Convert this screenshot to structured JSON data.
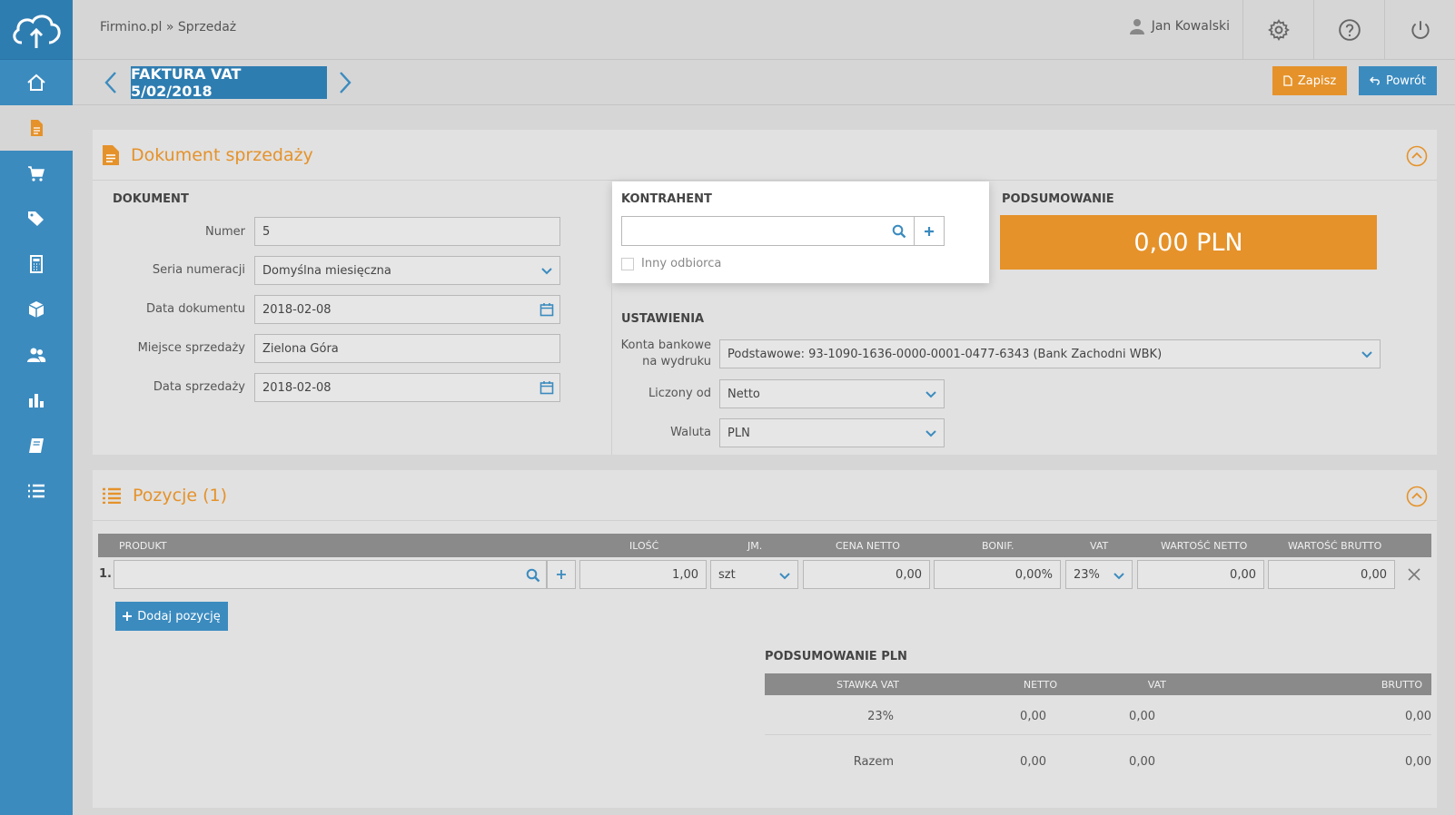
{
  "header": {
    "breadcrumb": "Firmino.pl » Sprzedaż",
    "user_name": "Jan Kowalski"
  },
  "toolbar": {
    "document_title": "FAKTURA VAT 5/02/2018",
    "save_label": "Zapisz",
    "back_label": "Powrót"
  },
  "sales_panel": {
    "title": "Dokument sprzedaży",
    "dokument": {
      "section_label": "DOKUMENT",
      "numer_label": "Numer",
      "numer_value": "5",
      "seria_label": "Seria numeracji",
      "seria_value": "Domyślna miesięczna",
      "data_dok_label": "Data dokumentu",
      "data_dok_value": "2018-02-08",
      "miejsce_label": "Miejsce sprzedaży",
      "miejsce_value": "Zielona Góra",
      "data_sprz_label": "Data sprzedaży",
      "data_sprz_value": "2018-02-08"
    },
    "kontrahent": {
      "section_label": "KONTRAHENT",
      "search_value": "",
      "other_recipient_label": "Inny odbiorca"
    },
    "podsumowanie": {
      "section_label": "PODSUMOWANIE",
      "total": "0,00 PLN"
    },
    "ustawienia": {
      "section_label": "USTAWIENIA",
      "konta_label_1": "Konta bankowe",
      "konta_label_2": "na wydruku",
      "konta_value": "Podstawowe: 93-1090-1636-0000-0001-0477-6343 (Bank Zachodni WBK)",
      "liczony_label": "Liczony od",
      "liczony_value": "Netto",
      "waluta_label": "Waluta",
      "waluta_value": "PLN"
    }
  },
  "positions_panel": {
    "title": "Pozycje (1)",
    "columns": [
      "PRODUKT",
      "ILOŚĆ",
      "JM.",
      "CENA NETTO",
      "BONIF.",
      "VAT",
      "WARTOŚĆ NETTO",
      "WARTOŚĆ BRUTTO"
    ],
    "row": {
      "index": "1.",
      "product": "",
      "qty": "1,00",
      "unit": "szt",
      "net_price": "0,00",
      "discount": "0,00%",
      "vat": "23%",
      "net_value": "0,00",
      "gross_value": "0,00"
    },
    "add_label": "Dodaj pozycję",
    "summary": {
      "title": "PODSUMOWANIE PLN",
      "columns": [
        "STAWKA VAT",
        "NETTO",
        "VAT",
        "BRUTTO"
      ],
      "rows": [
        {
          "rate": "23%",
          "net": "0,00",
          "vat": "0,00",
          "gross": "0,00"
        },
        {
          "rate": "Razem",
          "net": "0,00",
          "vat": "0,00",
          "gross": "0,00"
        }
      ]
    }
  },
  "colors": {
    "sidebar": "#3b8bbf",
    "accent_orange": "#e5922a",
    "title_blue": "#2e7db1"
  }
}
